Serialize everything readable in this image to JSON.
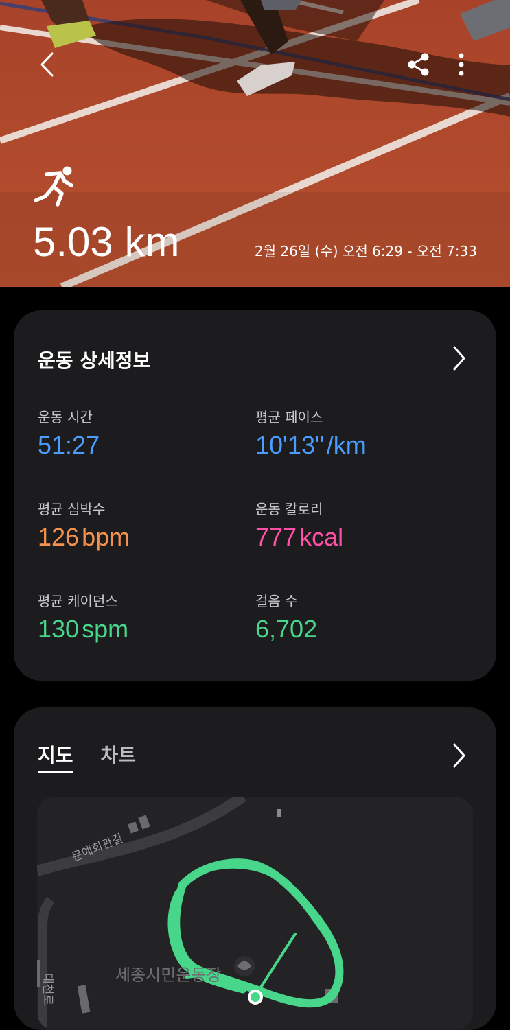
{
  "hero": {
    "distance": "5.03 km",
    "datetime": "2월 26일 (수) 오전 6:29 - 오전 7:33",
    "icons": {
      "back": "back-chevron-icon",
      "share": "share-icon",
      "more": "more-vertical-icon",
      "activity": "running-icon"
    }
  },
  "details": {
    "title": "운동 상세정보",
    "stats": [
      {
        "label": "운동 시간",
        "value": "51:27",
        "unit": "",
        "color": "#4b9eff"
      },
      {
        "label": "평균 페이스",
        "value": "10'13\"",
        "unit": "/km",
        "color": "#4b9eff"
      },
      {
        "label": "평균 심박수",
        "value": "126",
        "unit": "bpm",
        "color": "#f5934e"
      },
      {
        "label": "운동 칼로리",
        "value": "777",
        "unit": "kcal",
        "color": "#ff4fa7"
      },
      {
        "label": "평균 케이던스",
        "value": "130",
        "unit": "spm",
        "color": "#47d68a"
      },
      {
        "label": "걸음 수",
        "value": "6,702",
        "unit": "",
        "color": "#47d68a"
      }
    ]
  },
  "map_card": {
    "tabs": [
      {
        "label": "지도",
        "active": true
      },
      {
        "label": "차트",
        "active": false
      }
    ],
    "map": {
      "road_label_1": "문예회관길",
      "road_label_2": "대천로",
      "place_label": "세종시민운동장",
      "route_color": "#47d68a"
    }
  }
}
